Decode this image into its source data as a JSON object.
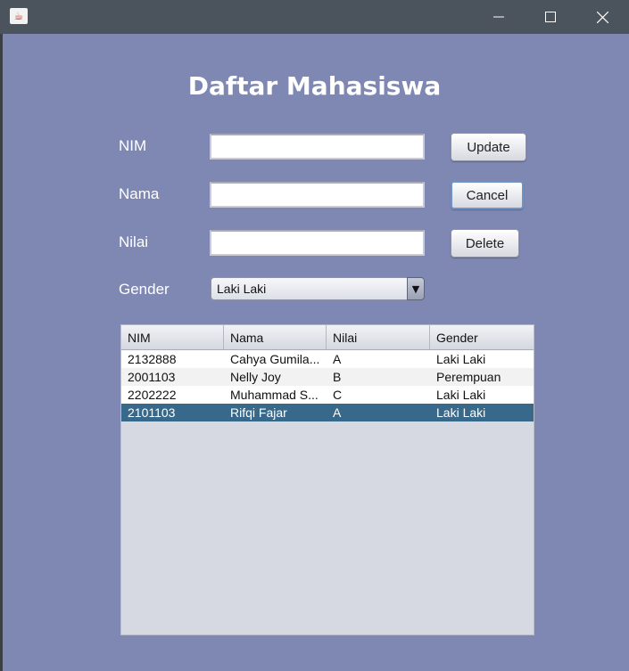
{
  "window": {
    "close_glyph": "✕",
    "minimize_glyph": "—",
    "maximize_glyph": "☐"
  },
  "heading": "Daftar Mahasiswa",
  "form": {
    "nim_label": "NIM",
    "nama_label": "Nama",
    "nilai_label": "Nilai",
    "gender_label": "Gender",
    "nim_value": "",
    "nama_value": "",
    "nilai_value": "",
    "gender_selected": "Laki Laki"
  },
  "buttons": {
    "update": "Update",
    "cancel": "Cancel",
    "delete": "Delete"
  },
  "table": {
    "columns": [
      "NIM",
      "Nama",
      "Nilai",
      "Gender"
    ],
    "rows": [
      [
        "2132888",
        "Cahya Gumila...",
        "A",
        "Laki Laki"
      ],
      [
        "2001103",
        "Nelly Joy",
        "B",
        "Perempuan"
      ],
      [
        "2202222",
        "Muhammad S...",
        "C",
        "Laki Laki"
      ],
      [
        "2101103",
        "Rifqi Fajar",
        "A",
        "Laki Laki"
      ]
    ],
    "selected_row": 3
  },
  "colors": {
    "background": "#7f88b3",
    "titlebar": "#4b535c",
    "selection": "#39698a"
  }
}
